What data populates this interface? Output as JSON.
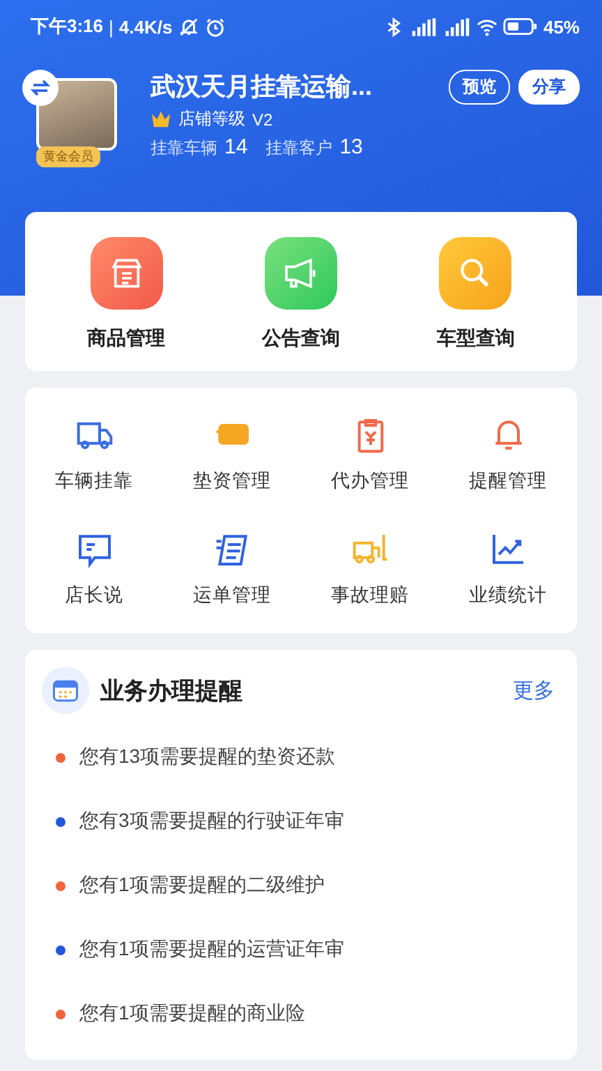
{
  "status_bar": {
    "time": "下午3:16",
    "separator": "|",
    "speed": "4.4K/s",
    "battery": "45%"
  },
  "store": {
    "name": "武汉天月挂靠运输...",
    "badge": "黄金会员",
    "level_label": "店铺等级",
    "level": "V2",
    "stats": [
      {
        "label": "挂靠车辆",
        "value": "14"
      },
      {
        "label": "挂靠客户",
        "value": "13"
      }
    ],
    "buttons": [
      {
        "label": "预览",
        "kind": "outline"
      },
      {
        "label": "分享",
        "kind": "filled"
      }
    ]
  },
  "quick_actions": [
    {
      "label": "商品管理",
      "kind": "shop"
    },
    {
      "label": "公告查询",
      "kind": "megaphone"
    },
    {
      "label": "车型查询",
      "kind": "search"
    }
  ],
  "tools": [
    {
      "label": "车辆挂靠",
      "kind": "truck"
    },
    {
      "label": "垫资管理",
      "kind": "card"
    },
    {
      "label": "代办管理",
      "kind": "clipboard"
    },
    {
      "label": "提醒管理",
      "kind": "bell"
    },
    {
      "label": "店长说",
      "kind": "message"
    },
    {
      "label": "运单管理",
      "kind": "list"
    },
    {
      "label": "事故理赔",
      "kind": "forklift"
    },
    {
      "label": "业绩统计",
      "kind": "chart"
    }
  ],
  "reminders": {
    "title": "业务办理提醒",
    "more": "更多",
    "items": [
      {
        "text": "您有13项需要提醒的垫资还款",
        "color": "#f0643c"
      },
      {
        "text": "您有3项需要提醒的行驶证年审",
        "color": "#2357d9"
      },
      {
        "text": "您有1项需要提醒的二级维护",
        "color": "#f0643c"
      },
      {
        "text": "您有1项需要提醒的运营证年审",
        "color": "#2357d9"
      },
      {
        "text": "您有1项需要提醒的商业险",
        "color": "#f0643c"
      }
    ]
  }
}
